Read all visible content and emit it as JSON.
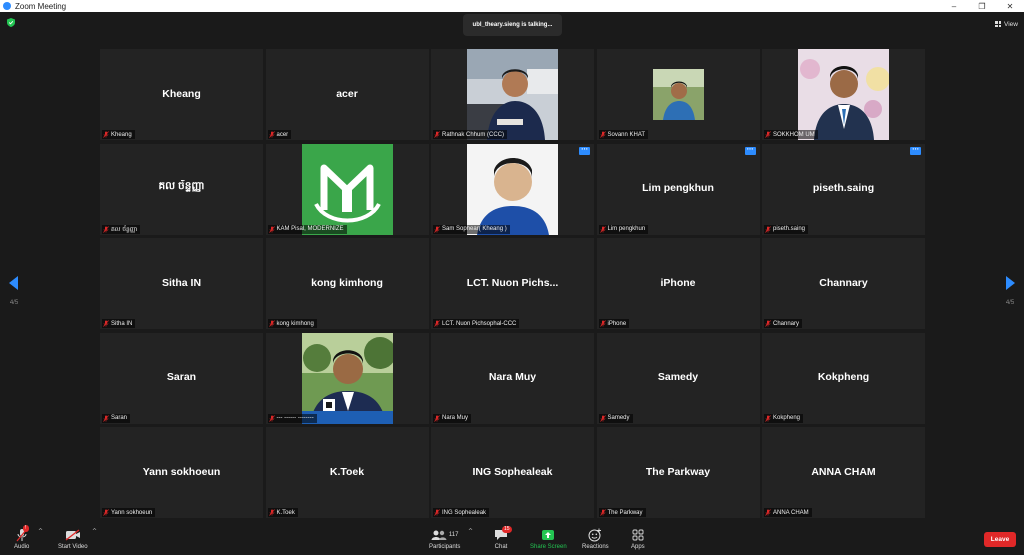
{
  "window": {
    "title": "Zoom Meeting",
    "controls": [
      "–",
      "❐",
      "✕"
    ]
  },
  "header": {
    "talking_text": "ubl_theary.sieng is talking...",
    "view_label": "View"
  },
  "pager": {
    "left_page": "4/5",
    "right_page": "4/5"
  },
  "participants": [
    {
      "display": "Kheang",
      "label": "Kheang",
      "photo": null
    },
    {
      "display": "acer",
      "label": "acer",
      "photo": null
    },
    {
      "display": "",
      "label": "Rathnak Chhum (CCC)",
      "photo": "man-blue-shirt-office"
    },
    {
      "display": "",
      "label": "Sovann KHAT",
      "photo": "small-man-photo"
    },
    {
      "display": "",
      "label": "SOKKHOM UM",
      "photo": "man-suit-flowers"
    },
    {
      "display": "គល ច័ន្ទញ្ញា",
      "label": "គល ច័ន្ទញ្ញា",
      "photo": null
    },
    {
      "display": "",
      "label": "KAM Pisal, MODERNIZE",
      "photo": "mt-logo-green"
    },
    {
      "display": "",
      "label": "Sam Sophear( Kheang )",
      "photo": "man-blue-white"
    },
    {
      "display": "Lim pengkhun",
      "label": "Lim pengkhun",
      "photo": null
    },
    {
      "display": "piseth.saing",
      "label": "piseth.saing",
      "photo": null
    },
    {
      "display": "Sitha IN",
      "label": "Sitha IN",
      "photo": null
    },
    {
      "display": "kong kimhong",
      "label": "kong kimhong",
      "photo": null
    },
    {
      "display": "LCT. Nuon Pichs...",
      "label": "LCT. Nuon Pichsophal-CCC",
      "photo": null
    },
    {
      "display": "iPhone",
      "label": "iPhone",
      "photo": null
    },
    {
      "display": "Channary",
      "label": "Channary",
      "photo": null
    },
    {
      "display": "Saran",
      "label": "Saran",
      "photo": null
    },
    {
      "display": "",
      "label": "--- ------ --------",
      "photo": "man-suit-trees"
    },
    {
      "display": "Nara Muy",
      "label": "Nara Muy",
      "photo": null
    },
    {
      "display": "Samedy",
      "label": "Samedy",
      "photo": null
    },
    {
      "display": "Kokpheng",
      "label": "Kokpheng",
      "photo": null
    },
    {
      "display": "Yann sokhoeun",
      "label": "Yann sokhoeun",
      "photo": null
    },
    {
      "display": "K.Toek",
      "label": "K.Toek",
      "photo": null
    },
    {
      "display": "ING Sophealeak",
      "label": "ING Sophealeak",
      "photo": null
    },
    {
      "display": "The Parkway",
      "label": "The Parkway",
      "photo": null
    },
    {
      "display": "ANNA CHAM",
      "label": "ANNA CHAM",
      "photo": null
    }
  ],
  "toolbar": {
    "audio": "Audio",
    "video": "Start Video",
    "participants": "Participants",
    "participants_count": "117",
    "chat": "Chat",
    "chat_badge": "15",
    "share": "Share Screen",
    "reactions": "Reactions",
    "apps": "Apps",
    "leave": "Leave"
  },
  "colors": {
    "accent": "#2d8cff",
    "share": "#23c552",
    "leave": "#e02828",
    "mic_muted": "#e02828"
  }
}
